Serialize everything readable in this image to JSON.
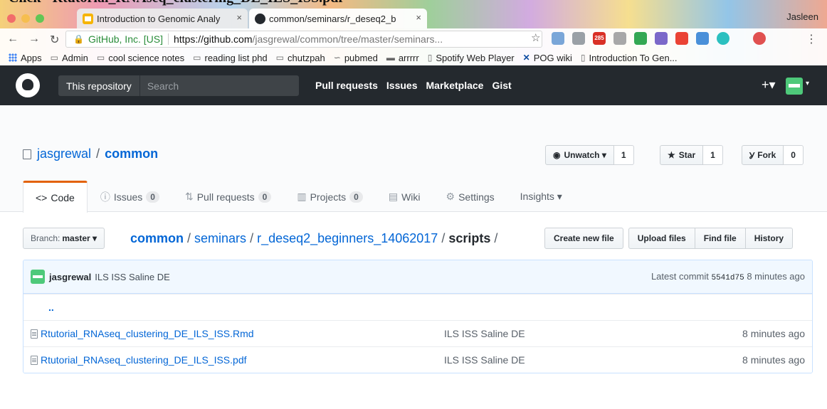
{
  "caption": "Click \"Rtutorial_RNAseq_clustering_DE_ILS_ISS.pdf\"",
  "browser": {
    "tabs": [
      {
        "title": "Introduction to Genomic Analy",
        "close": "×"
      },
      {
        "title": "common/seminars/r_deseq2_b",
        "close": "×"
      }
    ],
    "profile": "Jasleen",
    "secure_label": "GitHub, Inc. [US]",
    "url_host": "https://github.com",
    "url_path": "/jasgrewal/common/tree/master/seminars...",
    "bookmarks": [
      "Apps",
      "Admin",
      "cool science notes",
      "reading list phd",
      "chutzpah",
      "pubmed",
      "arrrrr",
      "Spotify Web Player",
      "POG wiki",
      "Introduction To Gen..."
    ],
    "ext_badge": "285"
  },
  "gh": {
    "scope": "This repository",
    "search_placeholder": "Search",
    "nav": [
      "Pull requests",
      "Issues",
      "Marketplace",
      "Gist"
    ],
    "plus": "+▾"
  },
  "repo": {
    "owner": "jasgrewal",
    "sep": "/",
    "name": "common",
    "watch_label": "Unwatch ▾",
    "watch_count": "1",
    "star_label": "Star",
    "star_count": "1",
    "fork_label": "Fork",
    "fork_count": "0",
    "tabs": [
      {
        "label": "Code",
        "icon": "<>",
        "count": null
      },
      {
        "label": "Issues",
        "icon": "ⓘ",
        "count": "0"
      },
      {
        "label": "Pull requests",
        "icon": "⇅",
        "count": "0"
      },
      {
        "label": "Projects",
        "icon": "▥",
        "count": "0"
      },
      {
        "label": "Wiki",
        "icon": "▤",
        "count": null
      },
      {
        "label": "Settings",
        "icon": "⚙",
        "count": null
      },
      {
        "label": "Insights ▾",
        "icon": "",
        "count": null
      }
    ]
  },
  "filenav": {
    "branch_prefix": "Branch:",
    "branch": "master ▾",
    "root": "common",
    "crumbs": [
      "seminars",
      "r_deseq2_beginners_14062017"
    ],
    "final": "scripts",
    "sep": " / ",
    "actions": [
      "Create new file",
      "Upload files",
      "Find file",
      "History"
    ]
  },
  "commit": {
    "author": "jasgrewal",
    "message": "ILS ISS Saline DE",
    "latest_prefix": "Latest commit",
    "sha": "5541d75",
    "age": "8 minutes ago"
  },
  "files": {
    "up": "..",
    "rows": [
      {
        "name": "Rtutorial_RNAseq_clustering_DE_ILS_ISS.Rmd",
        "message": "ILS ISS Saline DE",
        "age": "8 minutes ago"
      },
      {
        "name": "Rtutorial_RNAseq_clustering_DE_ILS_ISS.pdf",
        "message": "ILS ISS Saline DE",
        "age": "8 minutes ago"
      }
    ]
  }
}
